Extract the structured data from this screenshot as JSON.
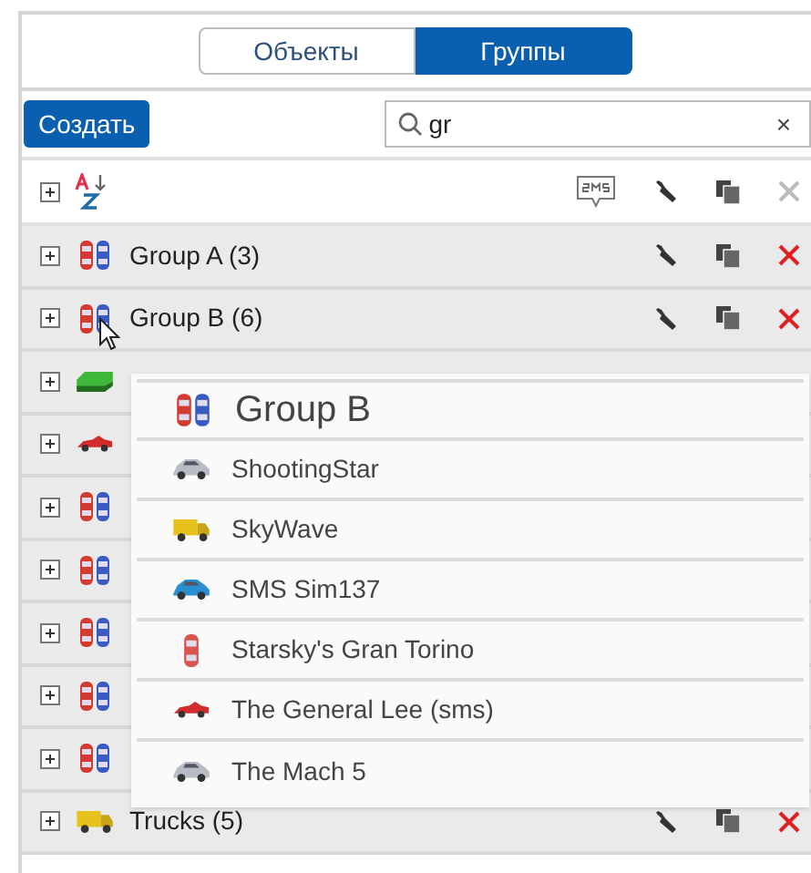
{
  "tabs": [
    {
      "label": "Объекты",
      "selected": false
    },
    {
      "label": "Группы",
      "selected": true
    }
  ],
  "create_button": "Создать",
  "search": {
    "value": "gr",
    "clear": "×"
  },
  "rows": [
    {
      "label": "Group A (3)",
      "kind": "pair"
    },
    {
      "label": "Group B (6)",
      "kind": "pair"
    },
    {
      "kind": "bus"
    },
    {
      "kind": "coupe"
    },
    {
      "kind": "pair"
    },
    {
      "kind": "pair"
    },
    {
      "kind": "pair"
    },
    {
      "kind": "pair"
    },
    {
      "kind": "pair"
    },
    {
      "label": "Trucks (5)",
      "kind": "truck"
    }
  ],
  "drag_preview": {
    "title": "Group B",
    "kind": "pair",
    "items": [
      {
        "label": "ShootingStar",
        "kind": "sedan"
      },
      {
        "label": "SkyWave",
        "kind": "truck"
      },
      {
        "label": "SMS Sim137",
        "kind": "bluecar"
      },
      {
        "label": "Starsky's Gran Torino",
        "kind": "topdown"
      },
      {
        "label": "The General Lee (sms)",
        "kind": "coupe"
      },
      {
        "label": "The Mach 5",
        "kind": "sedan"
      }
    ]
  }
}
